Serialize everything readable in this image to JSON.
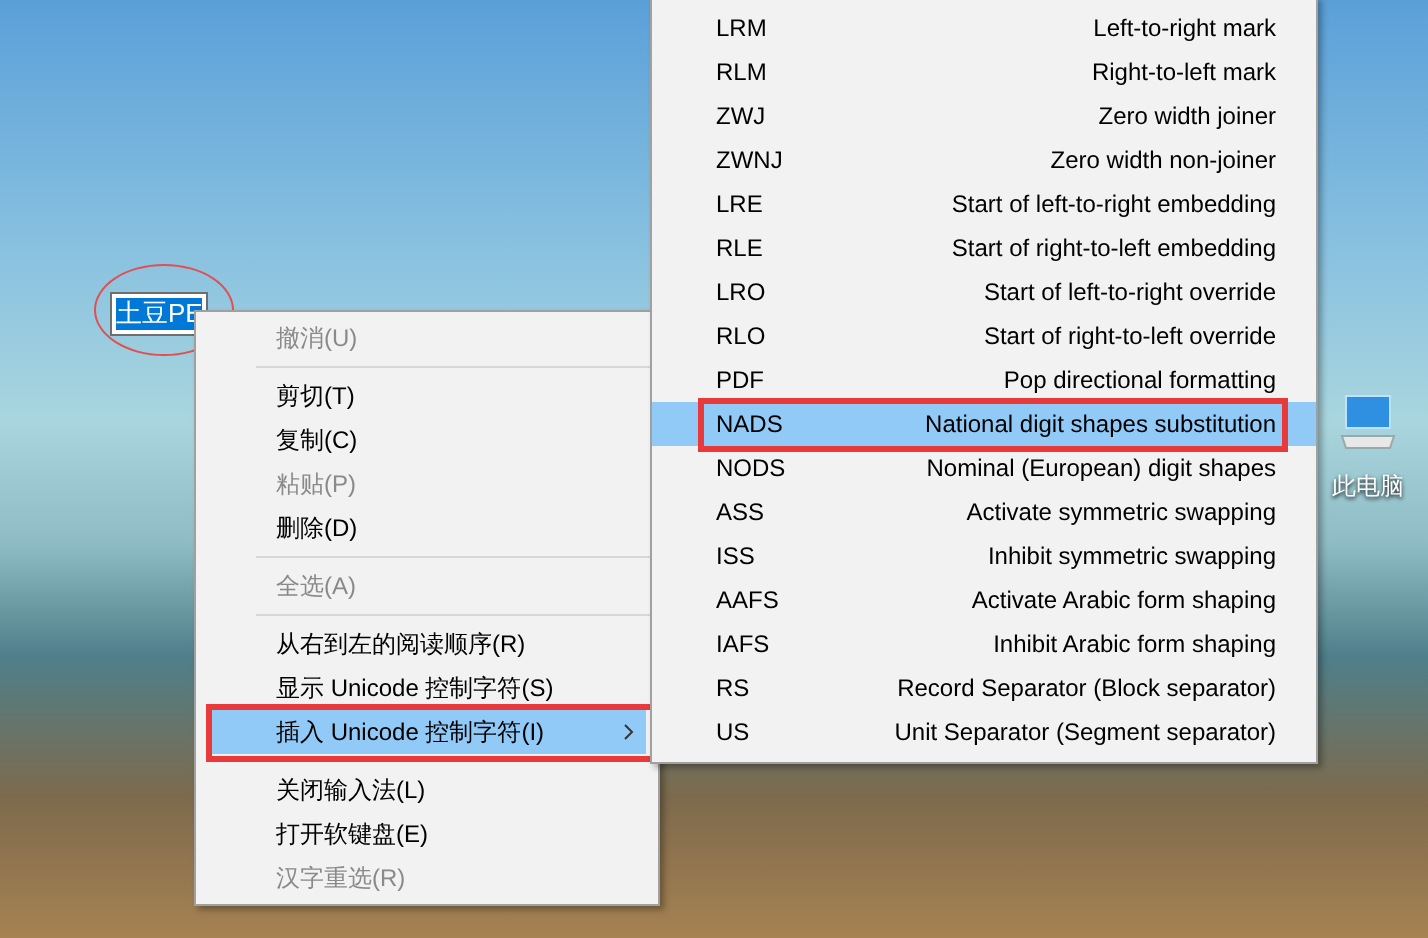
{
  "desktop": {
    "rename_field": {
      "value": "土豆PE",
      "selected": true,
      "annotated": true
    },
    "icons": [
      {
        "label": "此电脑"
      }
    ]
  },
  "context_menu": {
    "groups": [
      [
        {
          "label": "撤消(U)",
          "disabled": true,
          "selected": false,
          "submenu": false,
          "annotated": false
        }
      ],
      [
        {
          "label": "剪切(T)",
          "disabled": false,
          "selected": false,
          "submenu": false,
          "annotated": false
        },
        {
          "label": "复制(C)",
          "disabled": false,
          "selected": false,
          "submenu": false,
          "annotated": false
        },
        {
          "label": "粘贴(P)",
          "disabled": true,
          "selected": false,
          "submenu": false,
          "annotated": false
        },
        {
          "label": "删除(D)",
          "disabled": false,
          "selected": false,
          "submenu": false,
          "annotated": false
        }
      ],
      [
        {
          "label": "全选(A)",
          "disabled": true,
          "selected": false,
          "submenu": false,
          "annotated": false
        }
      ],
      [
        {
          "label": "从右到左的阅读顺序(R)",
          "disabled": false,
          "selected": false,
          "submenu": false,
          "annotated": false
        },
        {
          "label": "显示 Unicode 控制字符(S)",
          "disabled": false,
          "selected": false,
          "submenu": false,
          "annotated": false
        },
        {
          "label": "插入 Unicode 控制字符(I)",
          "disabled": false,
          "selected": true,
          "submenu": true,
          "annotated": true
        }
      ],
      [
        {
          "label": "关闭输入法(L)",
          "disabled": false,
          "selected": false,
          "submenu": false,
          "annotated": false
        },
        {
          "label": "打开软键盘(E)",
          "disabled": false,
          "selected": false,
          "submenu": false,
          "annotated": false
        },
        {
          "label": "汉字重选(R)",
          "disabled": true,
          "selected": false,
          "submenu": false,
          "annotated": false
        }
      ]
    ]
  },
  "submenu": {
    "items": [
      {
        "code": "LRM",
        "description": "Left-to-right mark",
        "selected": false,
        "annotated": false
      },
      {
        "code": "RLM",
        "description": "Right-to-left mark",
        "selected": false,
        "annotated": false
      },
      {
        "code": "ZWJ",
        "description": "Zero width joiner",
        "selected": false,
        "annotated": false
      },
      {
        "code": "ZWNJ",
        "description": "Zero width non-joiner",
        "selected": false,
        "annotated": false
      },
      {
        "code": "LRE",
        "description": "Start of left-to-right embedding",
        "selected": false,
        "annotated": false
      },
      {
        "code": "RLE",
        "description": "Start of right-to-left embedding",
        "selected": false,
        "annotated": false
      },
      {
        "code": "LRO",
        "description": "Start of left-to-right override",
        "selected": false,
        "annotated": false
      },
      {
        "code": "RLO",
        "description": "Start of right-to-left override",
        "selected": false,
        "annotated": false
      },
      {
        "code": "PDF",
        "description": "Pop directional formatting",
        "selected": false,
        "annotated": false
      },
      {
        "code": "NADS",
        "description": "National digit shapes substitution",
        "selected": true,
        "annotated": true
      },
      {
        "code": "NODS",
        "description": "Nominal (European) digit shapes",
        "selected": false,
        "annotated": false
      },
      {
        "code": "ASS",
        "description": "Activate symmetric swapping",
        "selected": false,
        "annotated": false
      },
      {
        "code": "ISS",
        "description": "Inhibit symmetric swapping",
        "selected": false,
        "annotated": false
      },
      {
        "code": "AAFS",
        "description": "Activate Arabic form shaping",
        "selected": false,
        "annotated": false
      },
      {
        "code": "IAFS",
        "description": "Inhibit Arabic form shaping",
        "selected": false,
        "annotated": false
      },
      {
        "code": "RS",
        "description": "Record Separator (Block separator)",
        "selected": false,
        "annotated": false
      },
      {
        "code": "US",
        "description": "Unit Separator (Segment separator)",
        "selected": false,
        "annotated": false
      }
    ]
  }
}
